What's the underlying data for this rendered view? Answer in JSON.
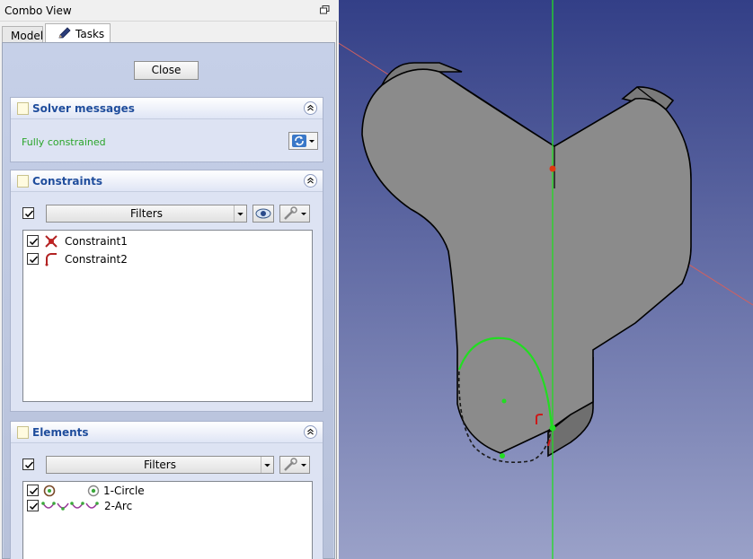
{
  "combo_view": {
    "title": "Combo View",
    "tabs": [
      {
        "label": "Model"
      },
      {
        "label": "Tasks"
      }
    ]
  },
  "tasks": {
    "close_label": "Close",
    "solver": {
      "title": "Solver messages",
      "status": "Fully constrained"
    },
    "constraints": {
      "title": "Constraints",
      "filters_label": "Filters",
      "items": [
        {
          "label": "Constraint1",
          "icon": "coincident-constraint-icon"
        },
        {
          "label": "Constraint2",
          "icon": "radius-constraint-icon"
        }
      ]
    },
    "elements": {
      "title": "Elements",
      "filters_label": "Filters",
      "items": [
        {
          "label": "1-Circle",
          "icon": "circle-element-icon"
        },
        {
          "label": "2-Arc",
          "icon": "arc-element-icon"
        }
      ]
    }
  },
  "colors": {
    "accent_title": "#1f4d9c",
    "status_ok": "#2aa52a",
    "sketch_geometry": "#22dd22",
    "axis_x": "#d06060",
    "axis_y": "#22dd22"
  }
}
